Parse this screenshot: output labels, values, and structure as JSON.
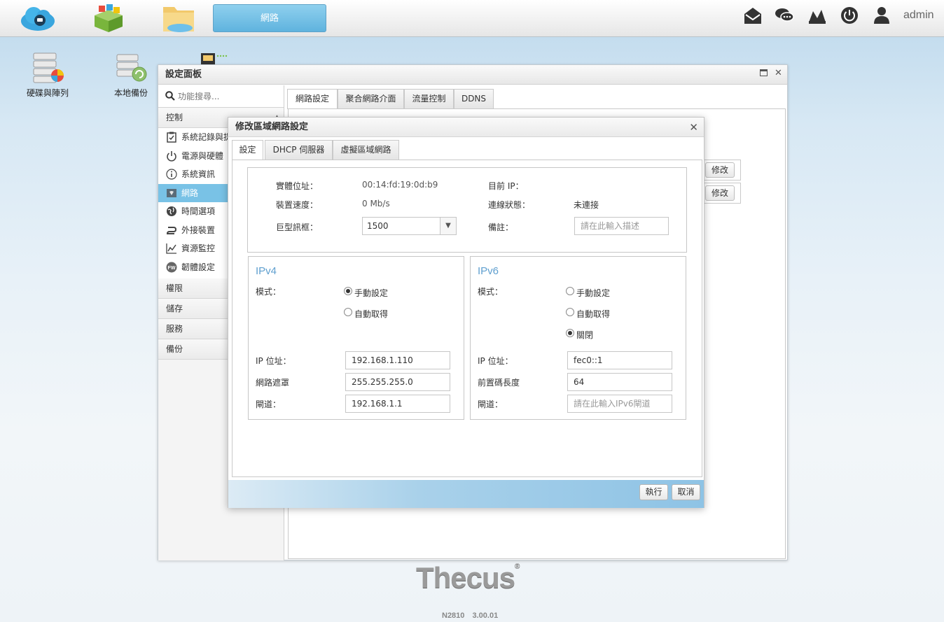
{
  "topbar": {
    "active_tab": "網路",
    "user": "admin",
    "left_icons": [
      "cloud-icon",
      "app-store-icon",
      "folder-icon"
    ],
    "right_icons": [
      "mail-icon",
      "chat-icon",
      "network-status-icon",
      "power-icon",
      "user-icon"
    ]
  },
  "desktop": {
    "icons": [
      {
        "label": "硬碟與陣列",
        "icon": "disk-array-icon"
      },
      {
        "label": "本地備份",
        "icon": "local-backup-icon"
      }
    ]
  },
  "panel": {
    "title": "設定面板",
    "search_placeholder": "功能搜尋...",
    "sections": {
      "control": "控制",
      "permission": "權限",
      "storage": "儲存",
      "service": "服務",
      "backup": "備份"
    },
    "control_items": [
      {
        "label": "系統記錄與提",
        "icon": "clipboard-icon"
      },
      {
        "label": "電源與硬體",
        "icon": "power-icon"
      },
      {
        "label": "系統資訊",
        "icon": "info-icon"
      },
      {
        "label": "網路",
        "icon": "network-icon",
        "active": true
      },
      {
        "label": "時間選項",
        "icon": "globe-icon"
      },
      {
        "label": "外接裝置",
        "icon": "usb-icon"
      },
      {
        "label": "資源監控",
        "icon": "chart-icon"
      },
      {
        "label": "韌體設定",
        "icon": "firmware-icon"
      }
    ],
    "tabs": [
      "網路設定",
      "聚合網路介面",
      "流量控制",
      "DDNS"
    ],
    "modify_label": "修改"
  },
  "dialog": {
    "title": "修改區域網路設定",
    "tabs": [
      "設定",
      "DHCP 伺服器",
      "虛擬區域網路"
    ],
    "info": {
      "mac_label": "實體位址：",
      "mac_value": "00:14:fd:19:0d:b9",
      "current_ip_label": "目前 IP：",
      "current_ip_value": "",
      "speed_label": "裝置速度：",
      "speed_value": "0 Mb/s",
      "link_label": "連線狀態：",
      "link_value": "未連接",
      "jumbo_label": "巨型訊框：",
      "jumbo_value": "1500",
      "note_label": "備註：",
      "note_placeholder": "請在此輸入描述"
    },
    "ipv4": {
      "title": "IPv4",
      "mode_label": "模式：",
      "options": [
        "手動設定",
        "自動取得"
      ],
      "selected": 0,
      "ip_label": "IP 位址：",
      "ip_value": "192.168.1.110",
      "mask_label": "網路遮罩",
      "mask_value": "255.255.255.0",
      "gw_label": "閘道：",
      "gw_value": "192.168.1.1"
    },
    "ipv6": {
      "title": "IPv6",
      "mode_label": "模式：",
      "options": [
        "手動設定",
        "自動取得",
        "關閉"
      ],
      "selected": 2,
      "ip_label": "IP 位址：",
      "ip_value": "fec0::1",
      "prefix_label": "前置碼長度",
      "prefix_value": "64",
      "gw_label": "閘道：",
      "gw_placeholder": "請在此輸入IPv6閘道"
    },
    "buttons": {
      "apply": "執行",
      "cancel": "取消"
    }
  },
  "footer": {
    "brand": "Thecus",
    "brand_mark": "®",
    "model": "N2810",
    "version": "3.00.01"
  },
  "colors": {
    "accent": "#79c2e6",
    "fieldset_title": "#5f9fcf"
  }
}
